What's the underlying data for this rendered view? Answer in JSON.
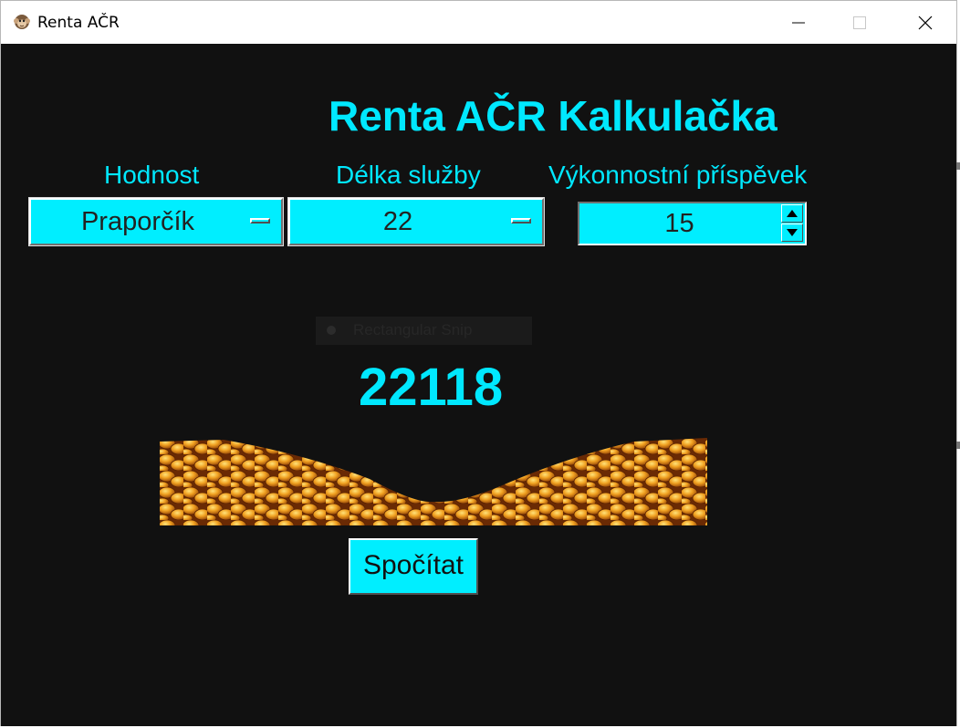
{
  "window": {
    "title": "Renta AČR",
    "app_icon": "monkey-icon",
    "controls": [
      "minimize-icon",
      "maximize-icon",
      "close-icon"
    ]
  },
  "colors": {
    "background": "#111111",
    "accent": "#00e8ff",
    "widget": "#00eeff"
  },
  "heading": "Renta AČR Kalkulačka",
  "fields": {
    "rank": {
      "label": "Hodnost",
      "value": "Praporčík"
    },
    "years": {
      "label": "Délka služby",
      "value": "22"
    },
    "performance": {
      "label": "Výkonnostní příspěvek",
      "value": "15"
    }
  },
  "overlay": {
    "snip_label": "Rectangular Snip"
  },
  "result": "22118",
  "image": {
    "icon": "gold-coins-image"
  },
  "calculate_button": "Spočítat"
}
